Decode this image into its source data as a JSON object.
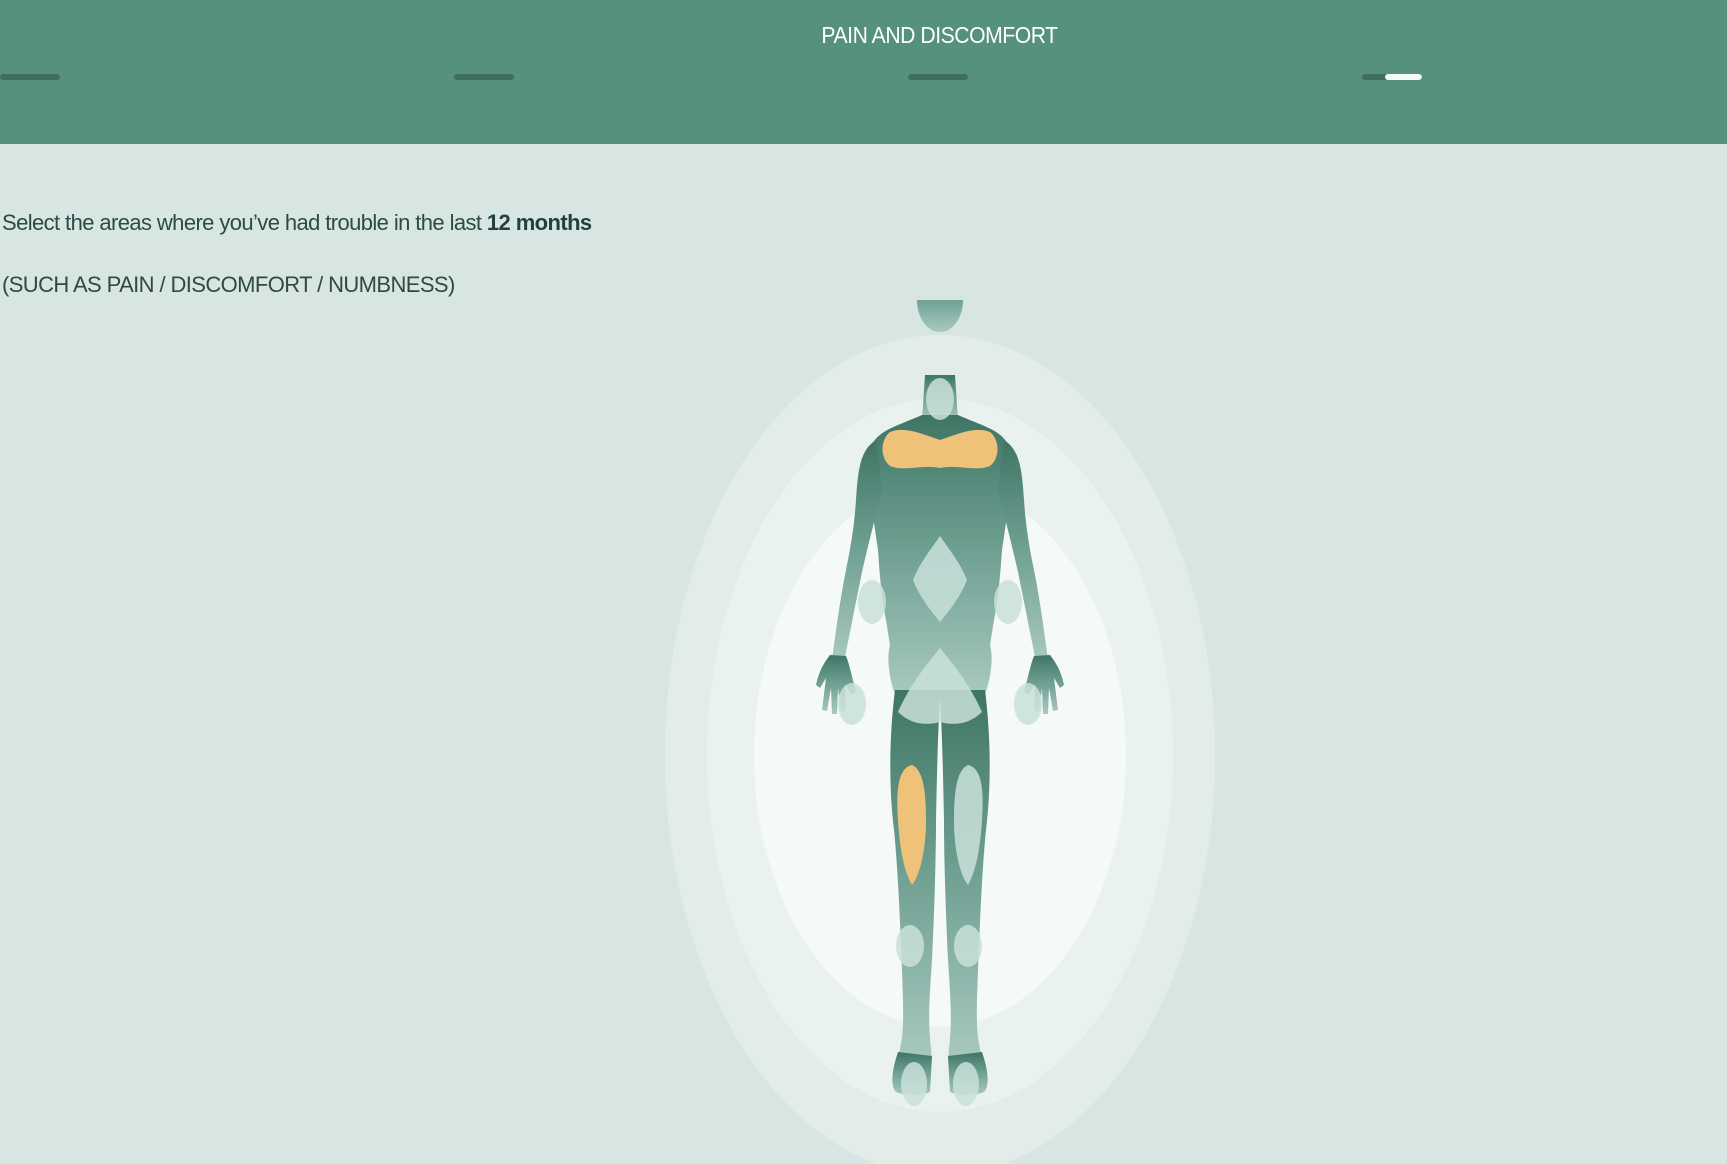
{
  "header": {
    "title": "PAIN AND DISCOMFORT",
    "progress": {
      "steps": 4,
      "current_step": 4,
      "current_step_fill": 0.62
    }
  },
  "question": {
    "prefix": "Select the areas where you’ve had trouble in the last ",
    "emphasis": "12 months",
    "subtitle": "(SUCH AS PAIN / DISCOMFORT / NUMBNESS)"
  },
  "body_map": {
    "selected_color": "#efc27a",
    "unselected_color": "#c9e0da",
    "silhouette_color": "#6f9e90",
    "zones": [
      {
        "name": "neck",
        "selected": false
      },
      {
        "name": "shoulders",
        "selected": true
      },
      {
        "name": "upper-back",
        "selected": false
      },
      {
        "name": "left-elbow",
        "selected": false
      },
      {
        "name": "right-elbow",
        "selected": false
      },
      {
        "name": "left-wrist",
        "selected": false
      },
      {
        "name": "right-wrist",
        "selected": false
      },
      {
        "name": "lower-back",
        "selected": false
      },
      {
        "name": "left-thigh",
        "selected": true
      },
      {
        "name": "right-thigh",
        "selected": false
      },
      {
        "name": "left-knee",
        "selected": false
      },
      {
        "name": "right-knee",
        "selected": false
      },
      {
        "name": "left-ankle",
        "selected": false
      },
      {
        "name": "right-ankle",
        "selected": false
      }
    ]
  }
}
